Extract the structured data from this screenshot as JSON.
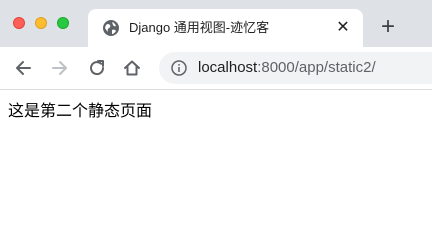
{
  "tab": {
    "title": "Django 通用视图-迹忆客",
    "close_glyph": "✕",
    "favicon": "globe-icon"
  },
  "new_tab_glyph": "+",
  "address_bar": {
    "host": "localhost",
    "path": ":8000/app/static2/",
    "icon": "info-icon"
  },
  "page": {
    "text": "这是第二个静态页面"
  },
  "colors": {
    "titlebar": "#dee1e6",
    "close": "#ff5f57",
    "minimize": "#febc2e",
    "maximize": "#28c840",
    "omnibox": "#f1f3f4"
  }
}
